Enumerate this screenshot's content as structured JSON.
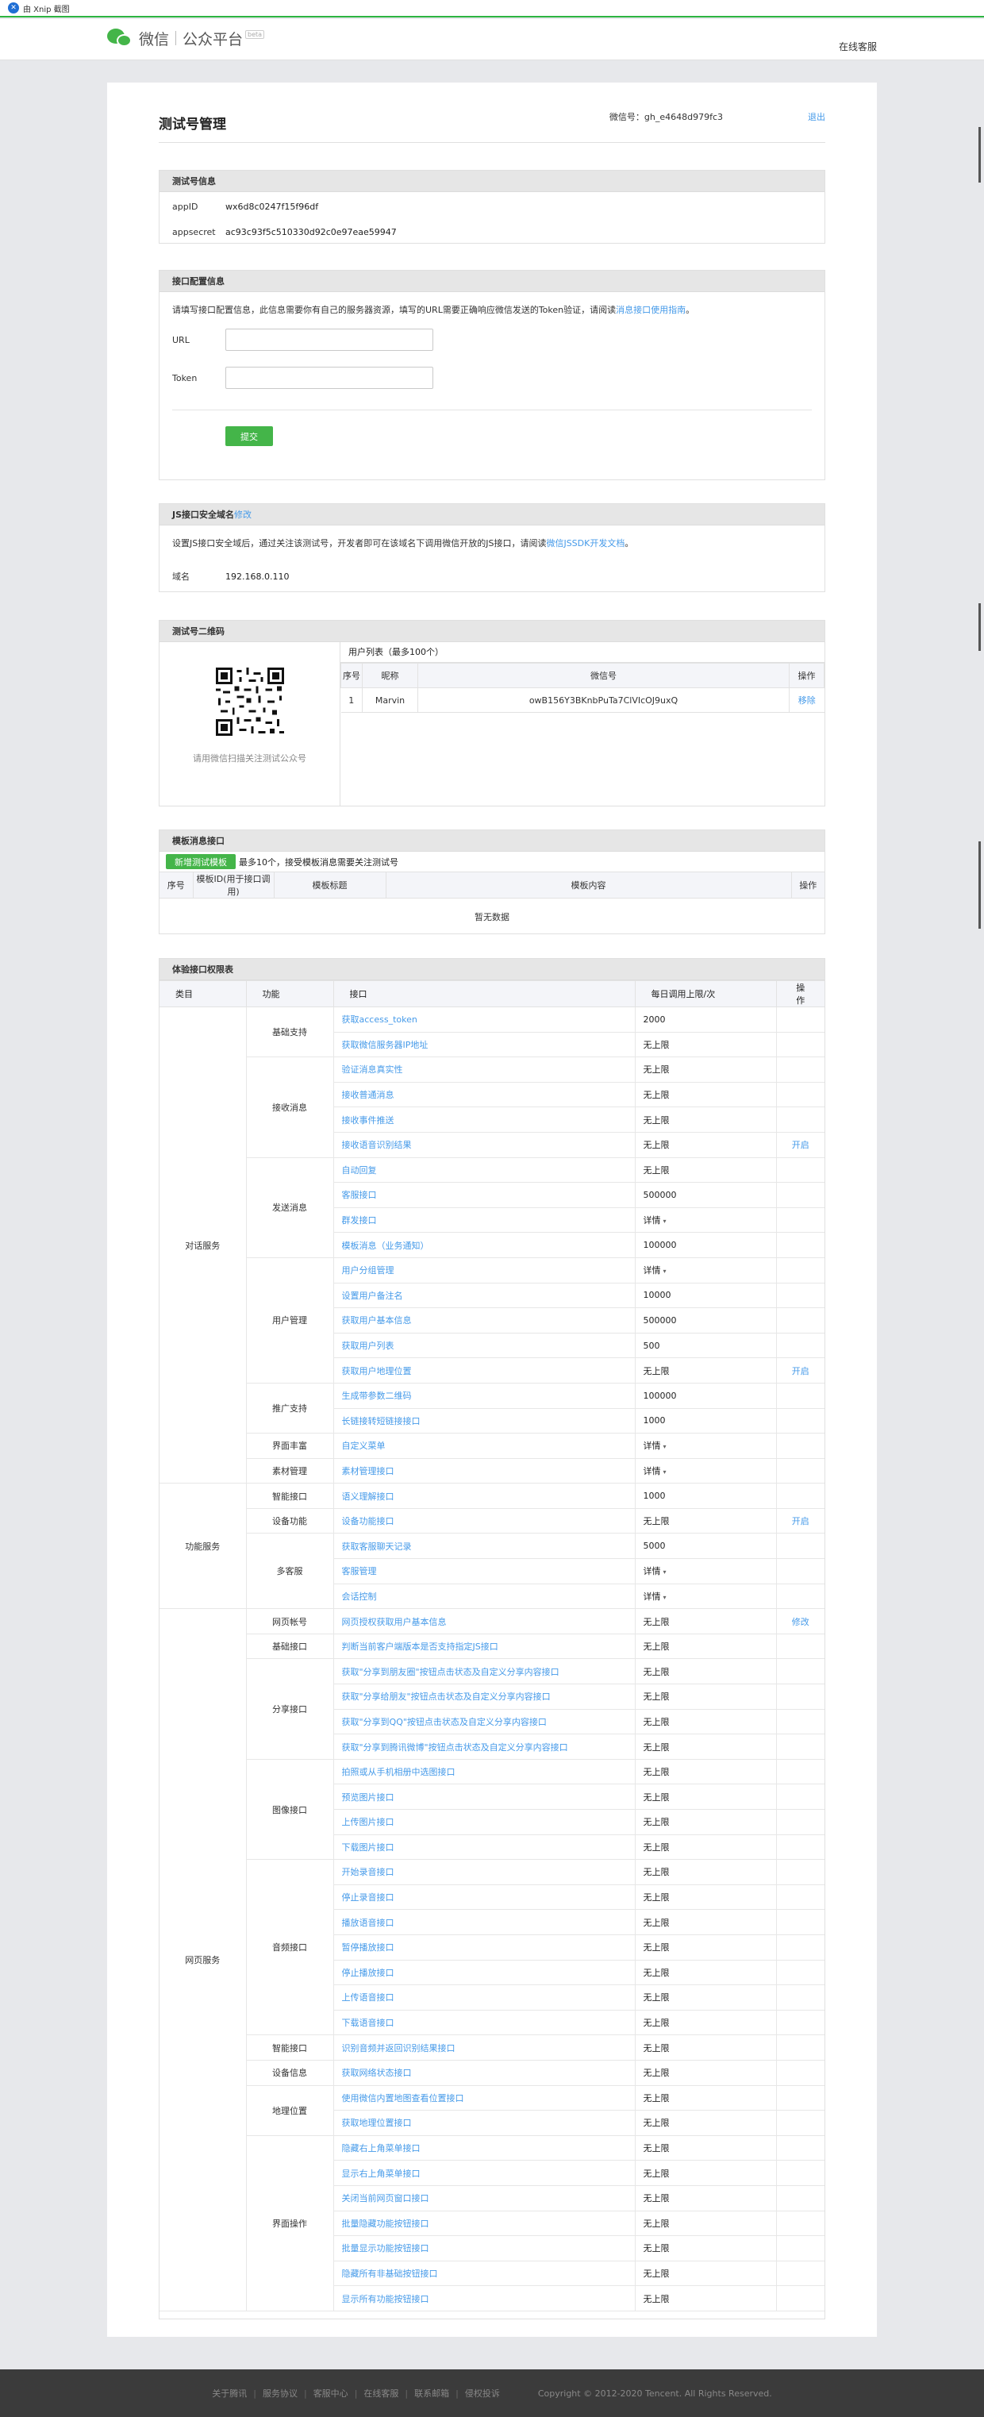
{
  "capture": {
    "label": "由 Xnip 截图"
  },
  "header": {
    "brand1": "微信",
    "brand2": "公众平台",
    "beta": "beta",
    "support": "在线客服"
  },
  "page": {
    "title": "测试号管理",
    "wx_id": "微信号：gh_e4648d979fc3",
    "logout": "退出"
  },
  "test_info": {
    "title": "测试号信息",
    "appid_label": "appID",
    "appid": "wx6d8c0247f15f96df",
    "secret_label": "appsecret",
    "secret": "ac93c93f5c510330d92c0e97eae59947"
  },
  "iface": {
    "title": "接口配置信息",
    "desc": "请填写接口配置信息，此信息需要你有自己的服务器资源，填写的URL需要正确响应微信发送的Token验证，请阅读",
    "desc_link": "消息接口使用指南",
    "desc_end": "。",
    "url_label": "URL",
    "token_label": "Token",
    "url_value": "",
    "token_value": "",
    "submit": "提交"
  },
  "js": {
    "title": "JS接口安全域名",
    "edit": "修改",
    "desc": "设置JS接口安全域后，通过关注该测试号，开发者即可在该域名下调用微信开放的JS接口，请阅读",
    "desc_link": "微信JSSDK开发文档",
    "desc_end": "。",
    "domain_label": "域名",
    "domain": "192.168.0.110"
  },
  "qr": {
    "title": "测试号二维码",
    "caption": "请用微信扫描关注测试公众号",
    "list_title": "用户列表（最多100个）",
    "cols": [
      "序号",
      "昵称",
      "微信号",
      "操作"
    ],
    "rows": [
      {
        "idx": "1",
        "nick": "Marvin",
        "wxid": "owB156Y3BKnbPuTa7ClVIcOJ9uxQ",
        "op": "移除"
      }
    ]
  },
  "tpl": {
    "title": "模板消息接口",
    "add": "新增测试模板",
    "hint": "最多10个，接受模板消息需要关注测试号",
    "cols": [
      "序号",
      "模板ID(用于接口调用)",
      "模板标题",
      "模板内容",
      "操作"
    ],
    "empty": "暂无数据"
  },
  "perm": {
    "title": "体验接口权限表",
    "cols": [
      "类目",
      "功能",
      "接口",
      "每日调用上限/次",
      "操作"
    ],
    "groups": [
      {
        "cat": "对话服务",
        "funcs": [
          {
            "name": "基础支持",
            "rows": [
              [
                "获取access_token",
                "2000",
                ""
              ],
              [
                "获取微信服务器IP地址",
                "无上限",
                ""
              ]
            ]
          },
          {
            "name": "接收消息",
            "rows": [
              [
                "验证消息真实性",
                "无上限",
                ""
              ],
              [
                "接收普通消息",
                "无上限",
                ""
              ],
              [
                "接收事件推送",
                "无上限",
                ""
              ],
              [
                "接收语音识别结果",
                "无上限",
                "开启"
              ]
            ]
          },
          {
            "name": "发送消息",
            "rows": [
              [
                "自动回复",
                "无上限",
                ""
              ],
              [
                "客服接口",
                "500000",
                ""
              ],
              [
                "群发接口",
                "详情",
                ""
              ],
              [
                "模板消息（业务通知）",
                "100000",
                ""
              ]
            ]
          },
          {
            "name": "用户管理",
            "rows": [
              [
                "用户分组管理",
                "详情",
                ""
              ],
              [
                "设置用户备注名",
                "10000",
                ""
              ],
              [
                "获取用户基本信息",
                "500000",
                ""
              ],
              [
                "获取用户列表",
                "500",
                ""
              ],
              [
                "获取用户地理位置",
                "无上限",
                "开启"
              ]
            ]
          },
          {
            "name": "推广支持",
            "rows": [
              [
                "生成带参数二维码",
                "100000",
                ""
              ],
              [
                "长链接转短链接接口",
                "1000",
                ""
              ]
            ]
          },
          {
            "name": "界面丰富",
            "rows": [
              [
                "自定义菜单",
                "详情",
                ""
              ]
            ]
          },
          {
            "name": "素材管理",
            "rows": [
              [
                "素材管理接口",
                "详情",
                ""
              ]
            ]
          }
        ]
      },
      {
        "cat": "功能服务",
        "funcs": [
          {
            "name": "智能接口",
            "rows": [
              [
                "语义理解接口",
                "1000",
                ""
              ]
            ]
          },
          {
            "name": "设备功能",
            "rows": [
              [
                "设备功能接口",
                "无上限",
                "开启"
              ]
            ]
          },
          {
            "name": "多客服",
            "rows": [
              [
                "获取客服聊天记录",
                "5000",
                ""
              ],
              [
                "客服管理",
                "详情",
                ""
              ],
              [
                "会话控制",
                "详情",
                ""
              ]
            ]
          }
        ]
      },
      {
        "cat": "网页服务",
        "funcs": [
          {
            "name": "网页帐号",
            "rows": [
              [
                "网页授权获取用户基本信息",
                "无上限",
                "修改"
              ]
            ]
          },
          {
            "name": "基础接口",
            "rows": [
              [
                "判断当前客户端版本是否支持指定JS接口",
                "无上限",
                ""
              ]
            ]
          },
          {
            "name": "分享接口",
            "rows": [
              [
                "获取\"分享到朋友圈\"按钮点击状态及自定义分享内容接口",
                "无上限",
                ""
              ],
              [
                "获取\"分享给朋友\"按钮点击状态及自定义分享内容接口",
                "无上限",
                ""
              ],
              [
                "获取\"分享到QQ\"按钮点击状态及自定义分享内容接口",
                "无上限",
                ""
              ],
              [
                "获取\"分享到腾讯微博\"按钮点击状态及自定义分享内容接口",
                "无上限",
                ""
              ]
            ]
          },
          {
            "name": "图像接口",
            "rows": [
              [
                "拍照或从手机相册中选图接口",
                "无上限",
                ""
              ],
              [
                "预览图片接口",
                "无上限",
                ""
              ],
              [
                "上传图片接口",
                "无上限",
                ""
              ],
              [
                "下载图片接口",
                "无上限",
                ""
              ]
            ]
          },
          {
            "name": "音频接口",
            "rows": [
              [
                "开始录音接口",
                "无上限",
                ""
              ],
              [
                "停止录音接口",
                "无上限",
                ""
              ],
              [
                "播放语音接口",
                "无上限",
                ""
              ],
              [
                "暂停播放接口",
                "无上限",
                ""
              ],
              [
                "停止播放接口",
                "无上限",
                ""
              ],
              [
                "上传语音接口",
                "无上限",
                ""
              ],
              [
                "下载语音接口",
                "无上限",
                ""
              ]
            ]
          },
          {
            "name": "智能接口",
            "rows": [
              [
                "识别音频并返回识别结果接口",
                "无上限",
                ""
              ]
            ]
          },
          {
            "name": "设备信息",
            "rows": [
              [
                "获取网络状态接口",
                "无上限",
                ""
              ]
            ]
          },
          {
            "name": "地理位置",
            "rows": [
              [
                "使用微信内置地图查看位置接口",
                "无上限",
                ""
              ],
              [
                "获取地理位置接口",
                "无上限",
                ""
              ]
            ]
          },
          {
            "name": "界面操作",
            "rows": [
              [
                "隐藏右上角菜单接口",
                "无上限",
                ""
              ],
              [
                "显示右上角菜单接口",
                "无上限",
                ""
              ],
              [
                "关闭当前网页窗口接口",
                "无上限",
                ""
              ],
              [
                "批量隐藏功能按钮接口",
                "无上限",
                ""
              ],
              [
                "批量显示功能按钮接口",
                "无上限",
                ""
              ],
              [
                "隐藏所有非基础按钮接口",
                "无上限",
                ""
              ],
              [
                "显示所有功能按钮接口",
                "无上限",
                ""
              ]
            ]
          }
        ]
      }
    ]
  },
  "footer": {
    "links": [
      "关于腾讯",
      "服务协议",
      "客服中心",
      "在线客服",
      "联系邮箱",
      "侵权投诉"
    ],
    "copyright": "Copyright © 2012-2020 Tencent. All Rights Reserved."
  }
}
